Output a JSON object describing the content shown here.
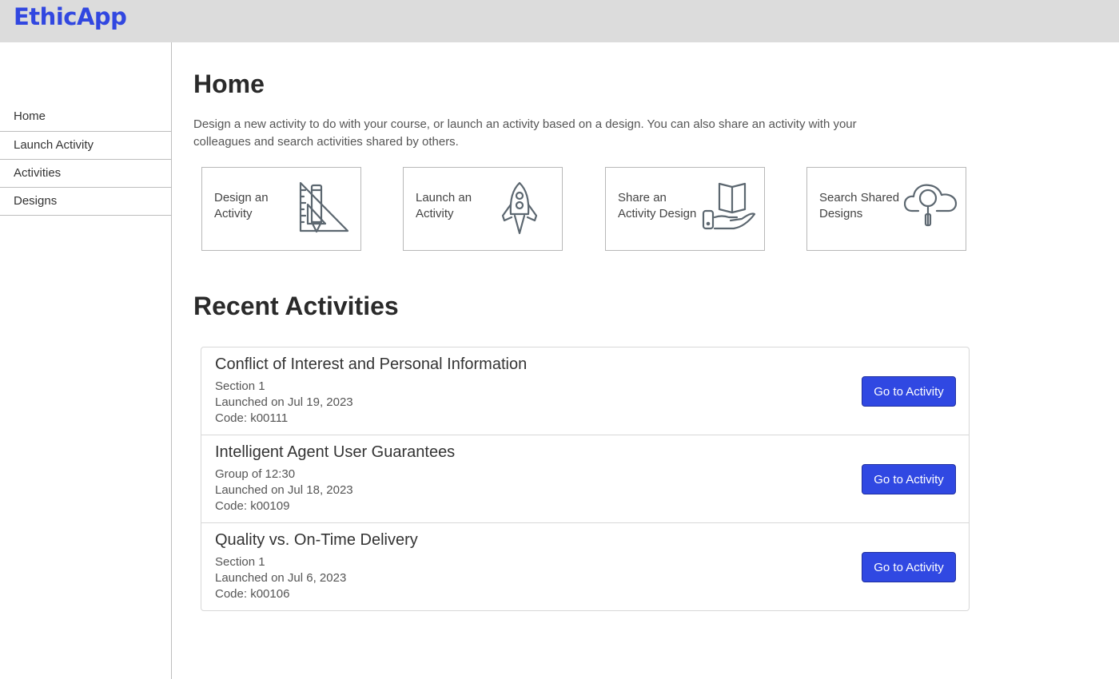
{
  "app": {
    "logo": "EthicApp"
  },
  "sidebar": {
    "items": [
      {
        "label": "Home"
      },
      {
        "label": "Launch Activity"
      },
      {
        "label": "Activities"
      },
      {
        "label": "Designs"
      }
    ]
  },
  "main": {
    "title": "Home",
    "intro": "Design a new activity to do with your course, or launch an activity based on a design. You can also share an activity with your colleagues and search activities shared by others.",
    "cards": [
      {
        "line1": "Design an",
        "line2": "Activity",
        "icon": "ruler-pencil-icon"
      },
      {
        "line1": "Launch an",
        "line2": "Activity",
        "icon": "rocket-icon"
      },
      {
        "line1": "Share an",
        "line2": "Activity Design",
        "icon": "share-book-hand-icon"
      },
      {
        "line1": "Search Shared",
        "line2": "Designs",
        "icon": "cloud-search-icon"
      }
    ],
    "recent_title": "Recent Activities",
    "activities": [
      {
        "title": "Conflict of Interest and Personal Information",
        "group": "Section 1",
        "launched": "Launched on Jul 19, 2023",
        "code": "Code: k00111",
        "button": "Go to Activity"
      },
      {
        "title": "Intelligent Agent User Guarantees",
        "group": "Group of 12:30",
        "launched": "Launched on Jul 18, 2023",
        "code": "Code: k00109",
        "button": "Go to Activity"
      },
      {
        "title": "Quality vs. On-Time Delivery",
        "group": "Section 1",
        "launched": "Launched on Jul 6, 2023",
        "code": "Code: k00106",
        "button": "Go to Activity"
      }
    ]
  },
  "colors": {
    "brand": "#3147e0",
    "button": "#3048e2",
    "icon_stroke": "#5c6770"
  }
}
